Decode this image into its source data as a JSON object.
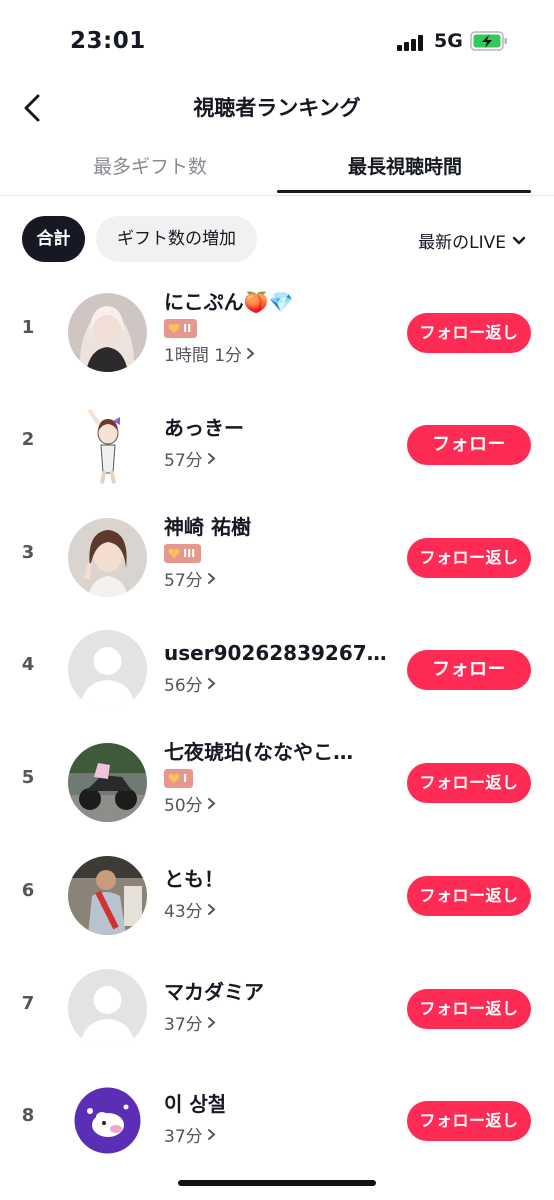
{
  "status": {
    "time": "23:01",
    "network": "5G"
  },
  "header": {
    "title": "視聴者ランキング"
  },
  "tabs": [
    {
      "label": "最多ギフト数"
    },
    {
      "label": "最長視聴時間"
    }
  ],
  "filters": {
    "total_label": "合計",
    "increase_label": "ギフト数の増加",
    "live_label": "最新のLIVE"
  },
  "viewers": [
    {
      "rank": "1",
      "name": "にこぷん🍑💎",
      "badge": "II",
      "duration": "1時間 1分",
      "button": "フォロー返し"
    },
    {
      "rank": "2",
      "name": "あっきー",
      "badge": "",
      "duration": "57分",
      "button": "フォロー"
    },
    {
      "rank": "3",
      "name": "神崎 祐樹",
      "badge": "III",
      "duration": "57分",
      "button": "フォロー返し"
    },
    {
      "rank": "4",
      "name": "user90262839267…",
      "badge": "",
      "duration": "56分",
      "button": "フォロー"
    },
    {
      "rank": "5",
      "name": "七夜琥珀(ななやこ…",
      "badge": "I",
      "duration": "50分",
      "button": "フォロー返し"
    },
    {
      "rank": "6",
      "name": "とも！",
      "badge": "",
      "duration": "43分",
      "button": "フォロー返し"
    },
    {
      "rank": "7",
      "name": "マカダミア",
      "badge": "",
      "duration": "37分",
      "button": "フォロー返し"
    },
    {
      "rank": "8",
      "name": "이 상철",
      "badge": "",
      "duration": "37分",
      "button": "フォロー返し"
    }
  ],
  "colors": {
    "accent": "#fe2c55",
    "badge": "#e7988e",
    "text": "#161823"
  }
}
